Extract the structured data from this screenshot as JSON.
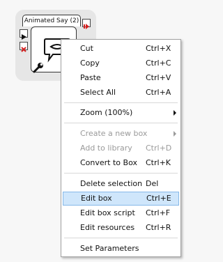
{
  "box": {
    "title": "Animated Say (2)"
  },
  "menu": {
    "items": [
      {
        "label": "Cut",
        "shortcut": "Ctrl+X"
      },
      {
        "label": "Copy",
        "shortcut": "Ctrl+C"
      },
      {
        "label": "Paste",
        "shortcut": "Ctrl+V"
      },
      {
        "label": "Select All",
        "shortcut": "Ctrl+A"
      },
      {
        "label": "Zoom (100%)",
        "shortcut": ""
      },
      {
        "label": "Create a new box",
        "shortcut": ""
      },
      {
        "label": "Add to library",
        "shortcut": "Ctrl+D"
      },
      {
        "label": "Convert to Box",
        "shortcut": "Ctrl+K"
      },
      {
        "label": "Delete selection",
        "shortcut": "Del"
      },
      {
        "label": "Edit box",
        "shortcut": "Ctrl+E"
      },
      {
        "label": "Edit box script",
        "shortcut": "Ctrl+F"
      },
      {
        "label": "Edit resources",
        "shortcut": "Ctrl+R"
      },
      {
        "label": "Set Parameters",
        "shortcut": ""
      }
    ]
  },
  "colors": {
    "highlight": "#cfe6fb",
    "disabled_text": "#9a9a9a",
    "stop_red": "#d62020"
  }
}
